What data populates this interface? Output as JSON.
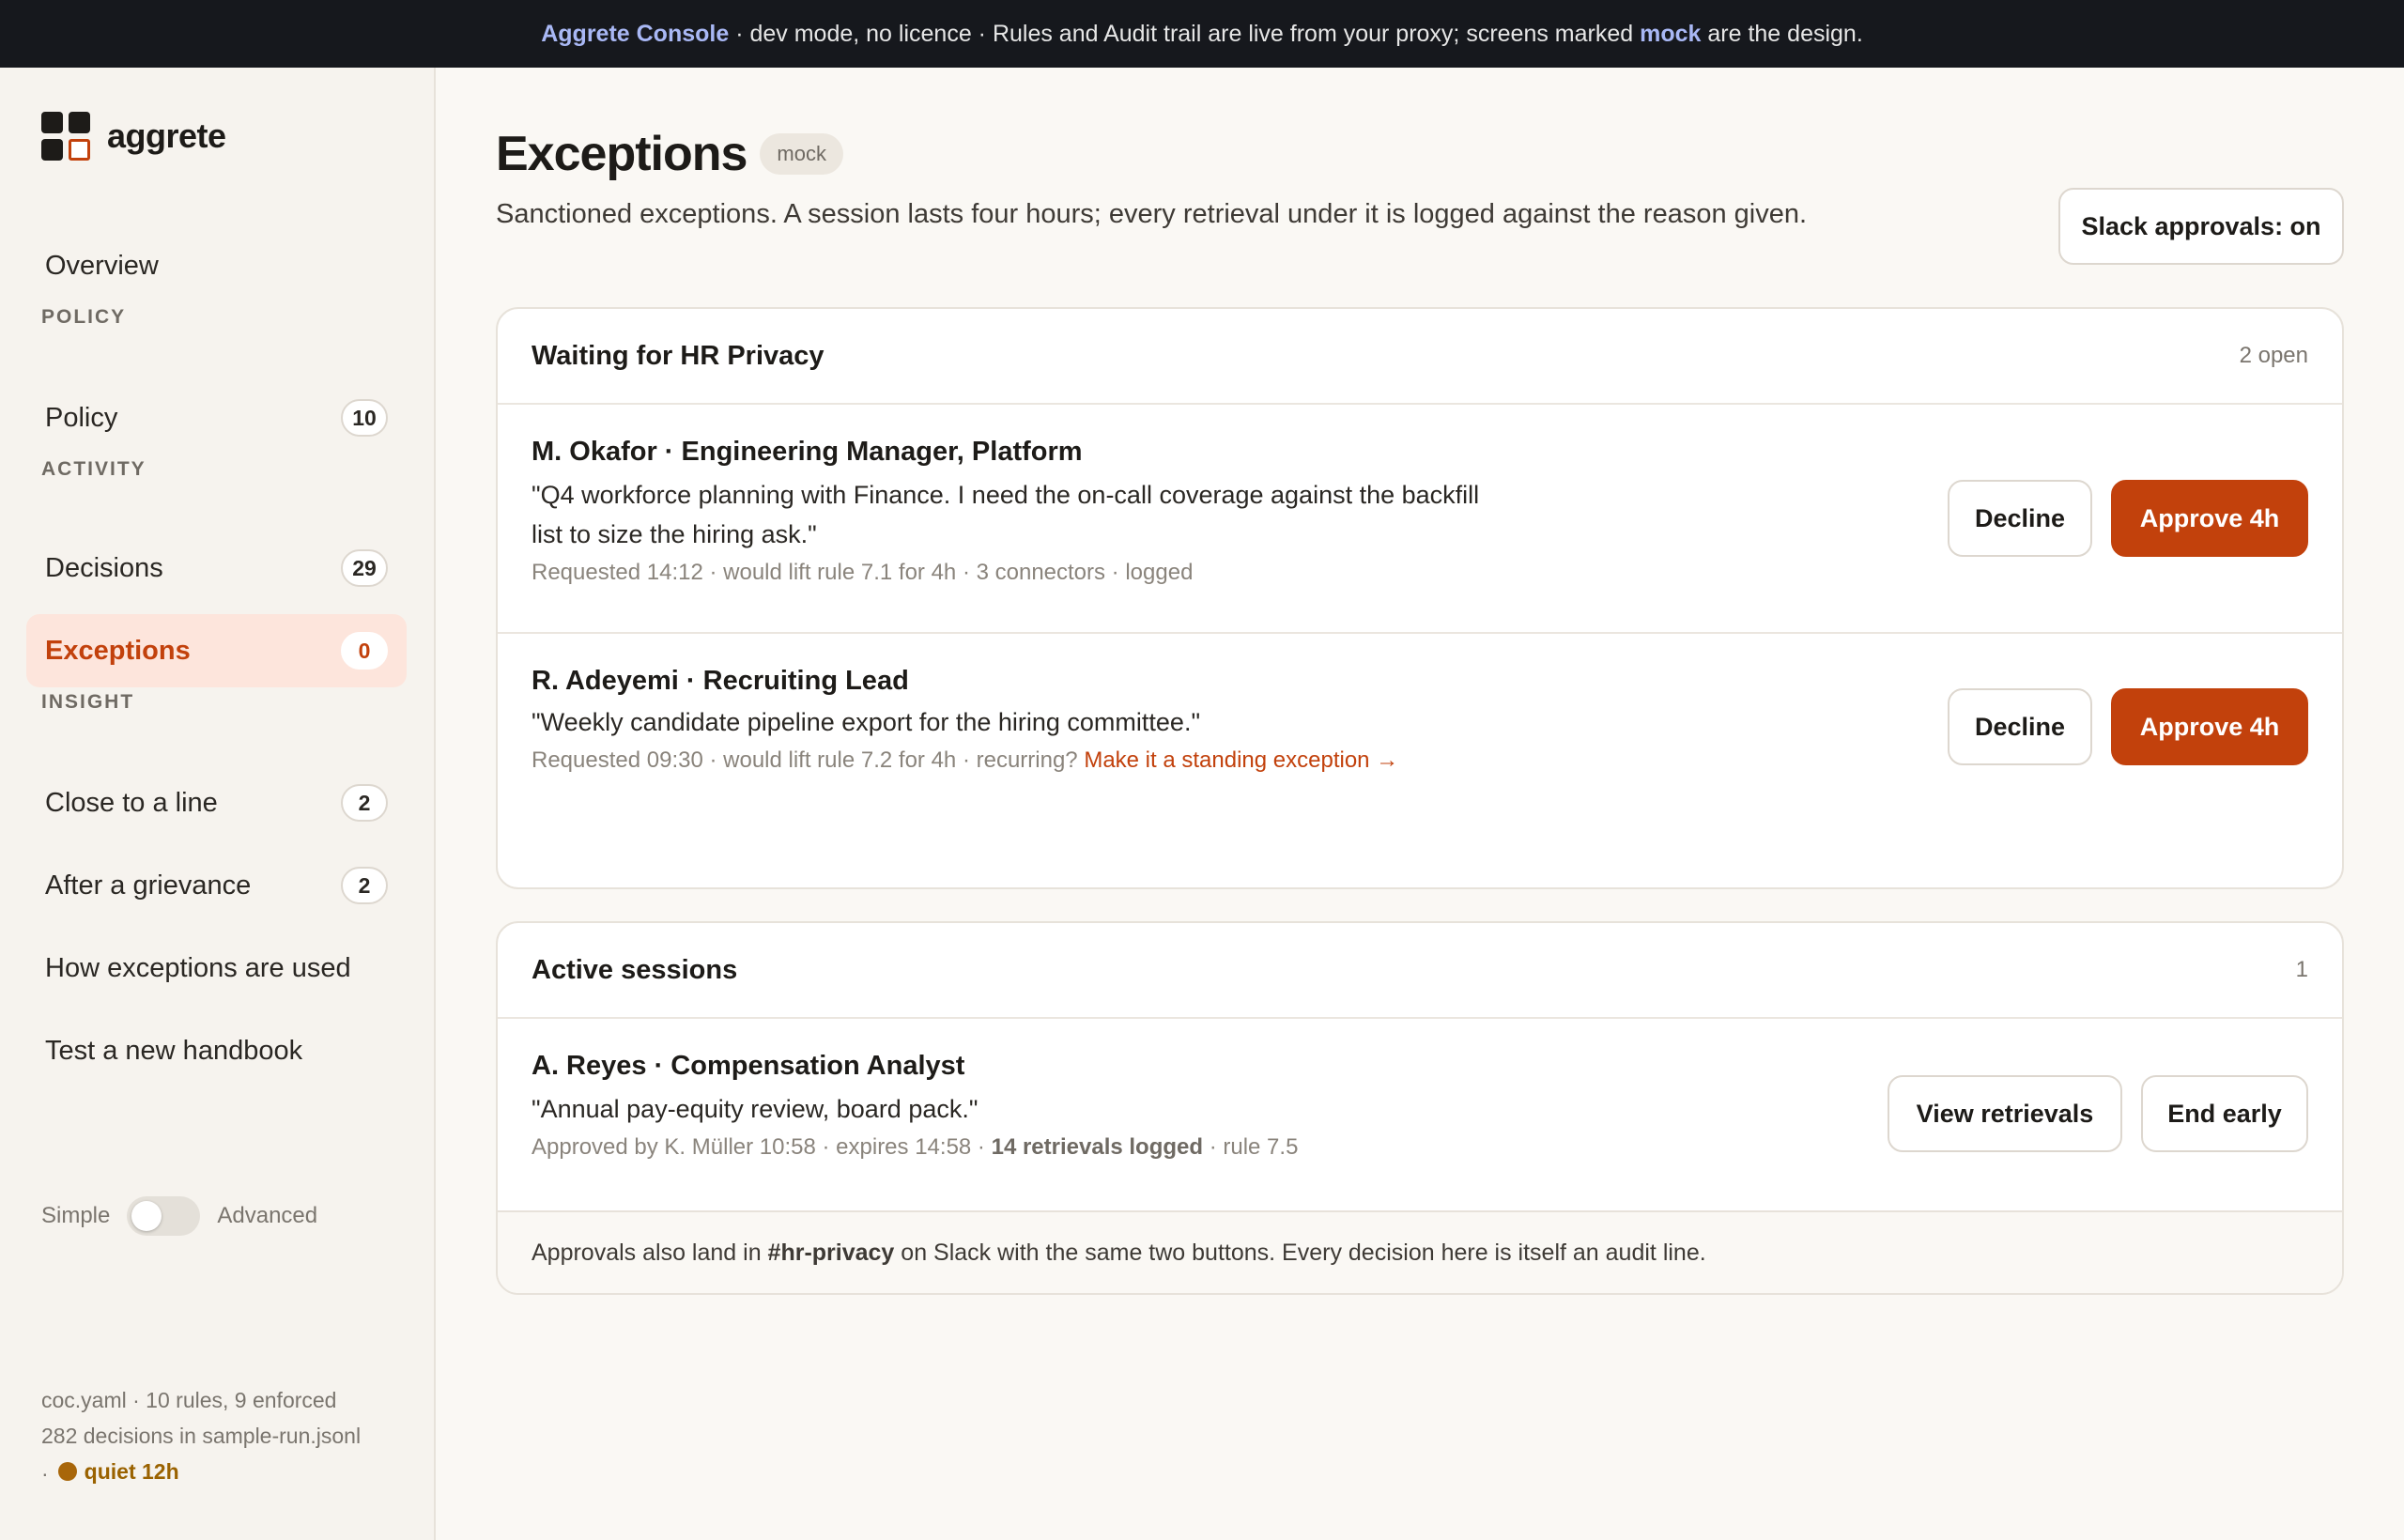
{
  "banner": {
    "app_name": "Aggrete Console",
    "text_1": " · dev mode, no licence · Rules and Audit trail are live from your proxy; screens marked ",
    "mock_word": "mock",
    "text_2": " are the design."
  },
  "brand": {
    "name": "aggrete",
    "accent": "#c2410c"
  },
  "sidebar": {
    "overview": "Overview",
    "sections": {
      "policy": "POLICY",
      "activity": "ACTIVITY",
      "insight": "INSIGHT"
    },
    "items": {
      "policy": {
        "label": "Policy",
        "count": "10"
      },
      "decisions": {
        "label": "Decisions",
        "count": "29"
      },
      "exceptions": {
        "label": "Exceptions",
        "count": "0"
      },
      "close_to_line": {
        "label": "Close to a line",
        "count": "2"
      },
      "after_grievance": {
        "label": "After a grievance",
        "count": "2"
      },
      "how_exceptions": {
        "label": "How exceptions are used"
      },
      "test_handbook": {
        "label": "Test a new handbook"
      }
    },
    "mode": {
      "left": "Simple",
      "right": "Advanced",
      "advanced_on": false
    },
    "footer": {
      "line1": "coc.yaml · 10 rules, 9 enforced",
      "line2": "282 decisions in sample-run.jsonl",
      "line3_prefix": "·",
      "quiet": "quiet 12h"
    }
  },
  "page": {
    "title": "Exceptions",
    "tag": "mock",
    "subtitle": "Sanctioned exceptions. A session lasts four hours; every retrieval under it is logged against the reason given.",
    "slack_button": "Slack approvals: on"
  },
  "waiting": {
    "title": "Waiting for HR Privacy",
    "count": "2 open",
    "requests": [
      {
        "name": "M. Okafor · Engineering Manager, Platform",
        "quote_line1": "\"Q4 workforce planning with Finance. I need the on-call coverage against the backfill",
        "quote_line2": "list to size the hiring ask.\"",
        "meta": "Requested 14:12 · would lift rule 7.1 for 4h · 3 connectors · logged",
        "decline": "Decline",
        "approve": "Approve 4h"
      },
      {
        "name": "R. Adeyemi · Recruiting Lead",
        "quote_line1": "\"Weekly candidate pipeline export for the hiring committee.\"",
        "meta": "Requested 09:30 · would lift rule 7.2 for 4h · recurring? ",
        "meta_link": "Make it a standing exception →",
        "decline": "Decline",
        "approve": "Approve 4h"
      }
    ]
  },
  "active": {
    "title": "Active sessions",
    "count": "1",
    "session": {
      "name": "A. Reyes · Compensation Analyst",
      "quote": "\"Annual pay-equity review, board pack.\"",
      "meta_1": "Approved by K. Müller 10:58 · expires 14:58 · ",
      "meta_strong": "14 retrievals logged",
      "meta_2": " · rule 7.5",
      "view": "View retrievals",
      "end": "End early"
    },
    "footer": {
      "text_1": "Approvals also land in ",
      "channel": "#hr-privacy",
      "text_2": " on Slack with the same two buttons. Every decision here is itself an audit line."
    }
  }
}
